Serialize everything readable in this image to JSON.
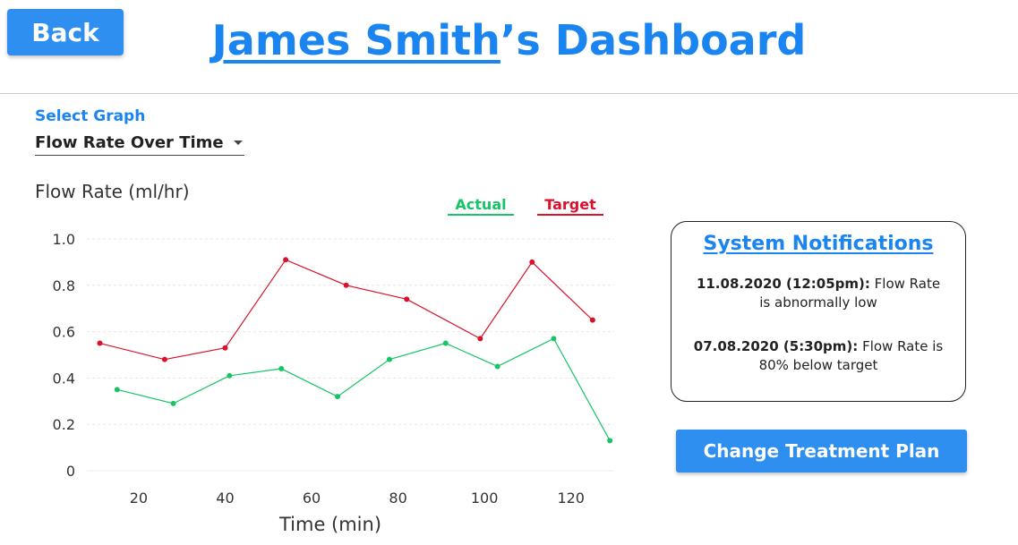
{
  "header": {
    "back_label": "Back",
    "title_name": "James Smith",
    "title_suffix": "’s  Dashboard"
  },
  "graph_select": {
    "label": "Select Graph",
    "value": "Flow Rate Over Time"
  },
  "notifications": {
    "title": "System Notifications",
    "items": [
      {
        "date": "11.08.2020 (12:05pm):",
        "text": " Flow Rate is abnormally low"
      },
      {
        "date": "07.08.2020 (5:30pm):",
        "text": " Flow Rate is 80% below target"
      }
    ]
  },
  "actions": {
    "change_treatment_label": "Change Treatment Plan"
  },
  "colors": {
    "accent": "#2e8ff0",
    "title": "#1a85f0",
    "actual": "#17c466",
    "target": "#d9112b"
  },
  "chart_data": {
    "type": "line",
    "title": "Flow Rate (ml/hr)",
    "xlabel": "Time (min)",
    "ylabel": "Flow Rate (ml/hr)",
    "xlim": [
      8,
      130
    ],
    "ylim": [
      0,
      1.0
    ],
    "x_ticks": [
      20,
      40,
      60,
      80,
      100,
      120
    ],
    "y_ticks": [
      0,
      0.2,
      0.4,
      0.6,
      0.8,
      1.0
    ],
    "y_tick_labels": [
      "0",
      "0.2",
      "0.4",
      "0.6",
      "0.8",
      "1.0"
    ],
    "grid": true,
    "legend_position": "top-right",
    "series": [
      {
        "name": "Actual",
        "color": "#17c466",
        "x": [
          15,
          28,
          41,
          53,
          66,
          78,
          91,
          103,
          116,
          129
        ],
        "y": [
          0.35,
          0.29,
          0.41,
          0.44,
          0.32,
          0.48,
          0.55,
          0.45,
          0.57,
          0.13
        ]
      },
      {
        "name": "Target",
        "color": "#d9112b",
        "x": [
          11,
          26,
          40,
          54,
          68,
          82,
          99,
          111,
          125
        ],
        "y": [
          0.55,
          0.48,
          0.53,
          0.91,
          0.8,
          0.74,
          0.57,
          0.9,
          0.65
        ]
      }
    ]
  }
}
